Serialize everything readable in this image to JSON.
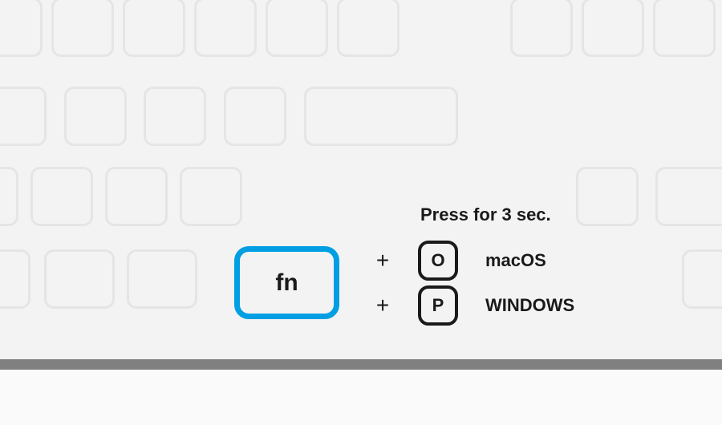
{
  "instruction": "Press for 3 sec.",
  "fn_key": {
    "label": "fn"
  },
  "combos": [
    {
      "plus": "+",
      "key_letter": "O",
      "os_label": "macOS"
    },
    {
      "plus": "+",
      "key_letter": "P",
      "os_label": "WINDOWS"
    }
  ]
}
